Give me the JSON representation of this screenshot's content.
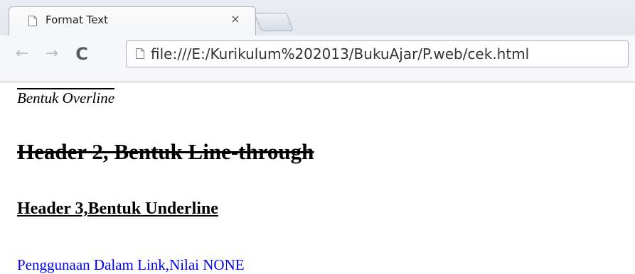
{
  "browser": {
    "tab": {
      "title": "Format Text",
      "close_glyph": "×",
      "icon": "page-icon"
    },
    "new_tab": {
      "icon": "new-tab-icon"
    },
    "toolbar": {
      "back_glyph": "←",
      "forward_glyph": "→",
      "reload_glyph": "C",
      "url": "file:///E:/Kurikulum%202013/BukuAjar/P.web/cek.html",
      "url_icon": "page-icon"
    }
  },
  "page": {
    "overline_text": "Bentuk Overline",
    "h2_text": "Header 2, Bentuk Line-through",
    "h3_text": "Header 3,Bentuk Underline",
    "link_text": "Penggunaan Dalam Link,Nilai NONE",
    "link_color": "#0000ee"
  }
}
